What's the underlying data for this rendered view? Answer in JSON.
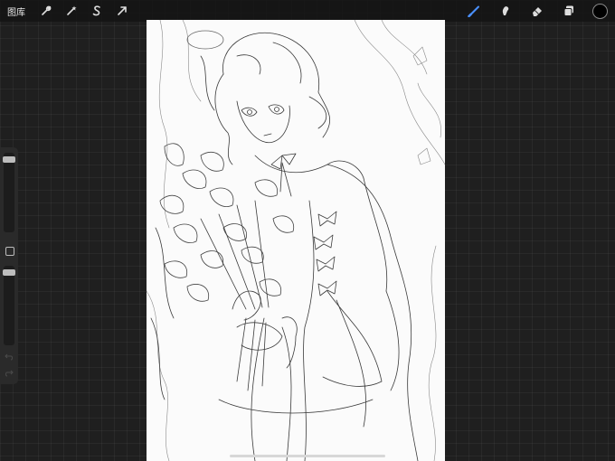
{
  "topbar": {
    "gallery_label": "图库",
    "left_tools": [
      "wrench-icon",
      "magic-wand-icon",
      "selection-icon",
      "transform-arrow-icon"
    ],
    "right_tools": [
      "brush-icon",
      "smudge-icon",
      "eraser-icon",
      "layers-icon"
    ],
    "active_tool": "brush-icon",
    "active_tool_color": "#4a90ff",
    "current_color": "#000000"
  },
  "sidebar": {
    "brush_size": 0.95,
    "opacity": 0.95,
    "controls": [
      "brush-size-slider",
      "modify-button",
      "opacity-slider",
      "undo-button",
      "redo-button"
    ]
  },
  "canvas": {
    "background": "#fbfbfb",
    "content": "pencil-sketch"
  }
}
